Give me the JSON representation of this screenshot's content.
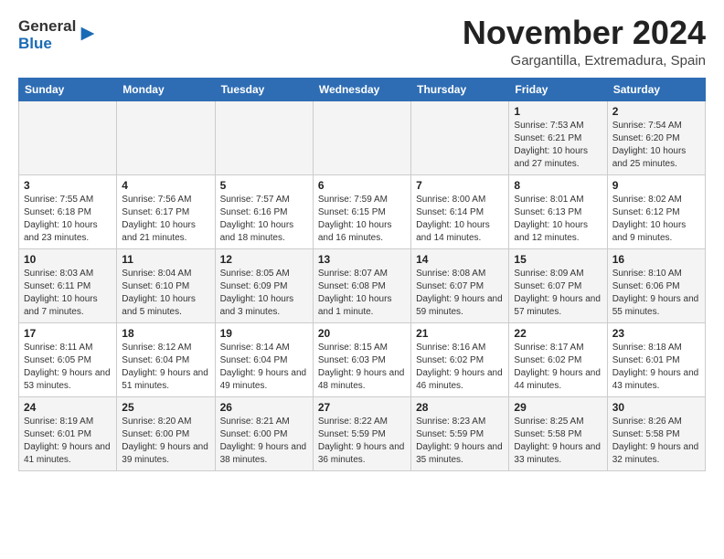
{
  "header": {
    "logo_line1": "General",
    "logo_line2": "Blue",
    "month_title": "November 2024",
    "location": "Gargantilla, Extremadura, Spain"
  },
  "days_of_week": [
    "Sunday",
    "Monday",
    "Tuesday",
    "Wednesday",
    "Thursday",
    "Friday",
    "Saturday"
  ],
  "weeks": [
    [
      {
        "day": "",
        "info": ""
      },
      {
        "day": "",
        "info": ""
      },
      {
        "day": "",
        "info": ""
      },
      {
        "day": "",
        "info": ""
      },
      {
        "day": "",
        "info": ""
      },
      {
        "day": "1",
        "info": "Sunrise: 7:53 AM\nSunset: 6:21 PM\nDaylight: 10 hours and 27 minutes."
      },
      {
        "day": "2",
        "info": "Sunrise: 7:54 AM\nSunset: 6:20 PM\nDaylight: 10 hours and 25 minutes."
      }
    ],
    [
      {
        "day": "3",
        "info": "Sunrise: 7:55 AM\nSunset: 6:18 PM\nDaylight: 10 hours and 23 minutes."
      },
      {
        "day": "4",
        "info": "Sunrise: 7:56 AM\nSunset: 6:17 PM\nDaylight: 10 hours and 21 minutes."
      },
      {
        "day": "5",
        "info": "Sunrise: 7:57 AM\nSunset: 6:16 PM\nDaylight: 10 hours and 18 minutes."
      },
      {
        "day": "6",
        "info": "Sunrise: 7:59 AM\nSunset: 6:15 PM\nDaylight: 10 hours and 16 minutes."
      },
      {
        "day": "7",
        "info": "Sunrise: 8:00 AM\nSunset: 6:14 PM\nDaylight: 10 hours and 14 minutes."
      },
      {
        "day": "8",
        "info": "Sunrise: 8:01 AM\nSunset: 6:13 PM\nDaylight: 10 hours and 12 minutes."
      },
      {
        "day": "9",
        "info": "Sunrise: 8:02 AM\nSunset: 6:12 PM\nDaylight: 10 hours and 9 minutes."
      }
    ],
    [
      {
        "day": "10",
        "info": "Sunrise: 8:03 AM\nSunset: 6:11 PM\nDaylight: 10 hours and 7 minutes."
      },
      {
        "day": "11",
        "info": "Sunrise: 8:04 AM\nSunset: 6:10 PM\nDaylight: 10 hours and 5 minutes."
      },
      {
        "day": "12",
        "info": "Sunrise: 8:05 AM\nSunset: 6:09 PM\nDaylight: 10 hours and 3 minutes."
      },
      {
        "day": "13",
        "info": "Sunrise: 8:07 AM\nSunset: 6:08 PM\nDaylight: 10 hours and 1 minute."
      },
      {
        "day": "14",
        "info": "Sunrise: 8:08 AM\nSunset: 6:07 PM\nDaylight: 9 hours and 59 minutes."
      },
      {
        "day": "15",
        "info": "Sunrise: 8:09 AM\nSunset: 6:07 PM\nDaylight: 9 hours and 57 minutes."
      },
      {
        "day": "16",
        "info": "Sunrise: 8:10 AM\nSunset: 6:06 PM\nDaylight: 9 hours and 55 minutes."
      }
    ],
    [
      {
        "day": "17",
        "info": "Sunrise: 8:11 AM\nSunset: 6:05 PM\nDaylight: 9 hours and 53 minutes."
      },
      {
        "day": "18",
        "info": "Sunrise: 8:12 AM\nSunset: 6:04 PM\nDaylight: 9 hours and 51 minutes."
      },
      {
        "day": "19",
        "info": "Sunrise: 8:14 AM\nSunset: 6:04 PM\nDaylight: 9 hours and 49 minutes."
      },
      {
        "day": "20",
        "info": "Sunrise: 8:15 AM\nSunset: 6:03 PM\nDaylight: 9 hours and 48 minutes."
      },
      {
        "day": "21",
        "info": "Sunrise: 8:16 AM\nSunset: 6:02 PM\nDaylight: 9 hours and 46 minutes."
      },
      {
        "day": "22",
        "info": "Sunrise: 8:17 AM\nSunset: 6:02 PM\nDaylight: 9 hours and 44 minutes."
      },
      {
        "day": "23",
        "info": "Sunrise: 8:18 AM\nSunset: 6:01 PM\nDaylight: 9 hours and 43 minutes."
      }
    ],
    [
      {
        "day": "24",
        "info": "Sunrise: 8:19 AM\nSunset: 6:01 PM\nDaylight: 9 hours and 41 minutes."
      },
      {
        "day": "25",
        "info": "Sunrise: 8:20 AM\nSunset: 6:00 PM\nDaylight: 9 hours and 39 minutes."
      },
      {
        "day": "26",
        "info": "Sunrise: 8:21 AM\nSunset: 6:00 PM\nDaylight: 9 hours and 38 minutes."
      },
      {
        "day": "27",
        "info": "Sunrise: 8:22 AM\nSunset: 5:59 PM\nDaylight: 9 hours and 36 minutes."
      },
      {
        "day": "28",
        "info": "Sunrise: 8:23 AM\nSunset: 5:59 PM\nDaylight: 9 hours and 35 minutes."
      },
      {
        "day": "29",
        "info": "Sunrise: 8:25 AM\nSunset: 5:58 PM\nDaylight: 9 hours and 33 minutes."
      },
      {
        "day": "30",
        "info": "Sunrise: 8:26 AM\nSunset: 5:58 PM\nDaylight: 9 hours and 32 minutes."
      }
    ]
  ]
}
